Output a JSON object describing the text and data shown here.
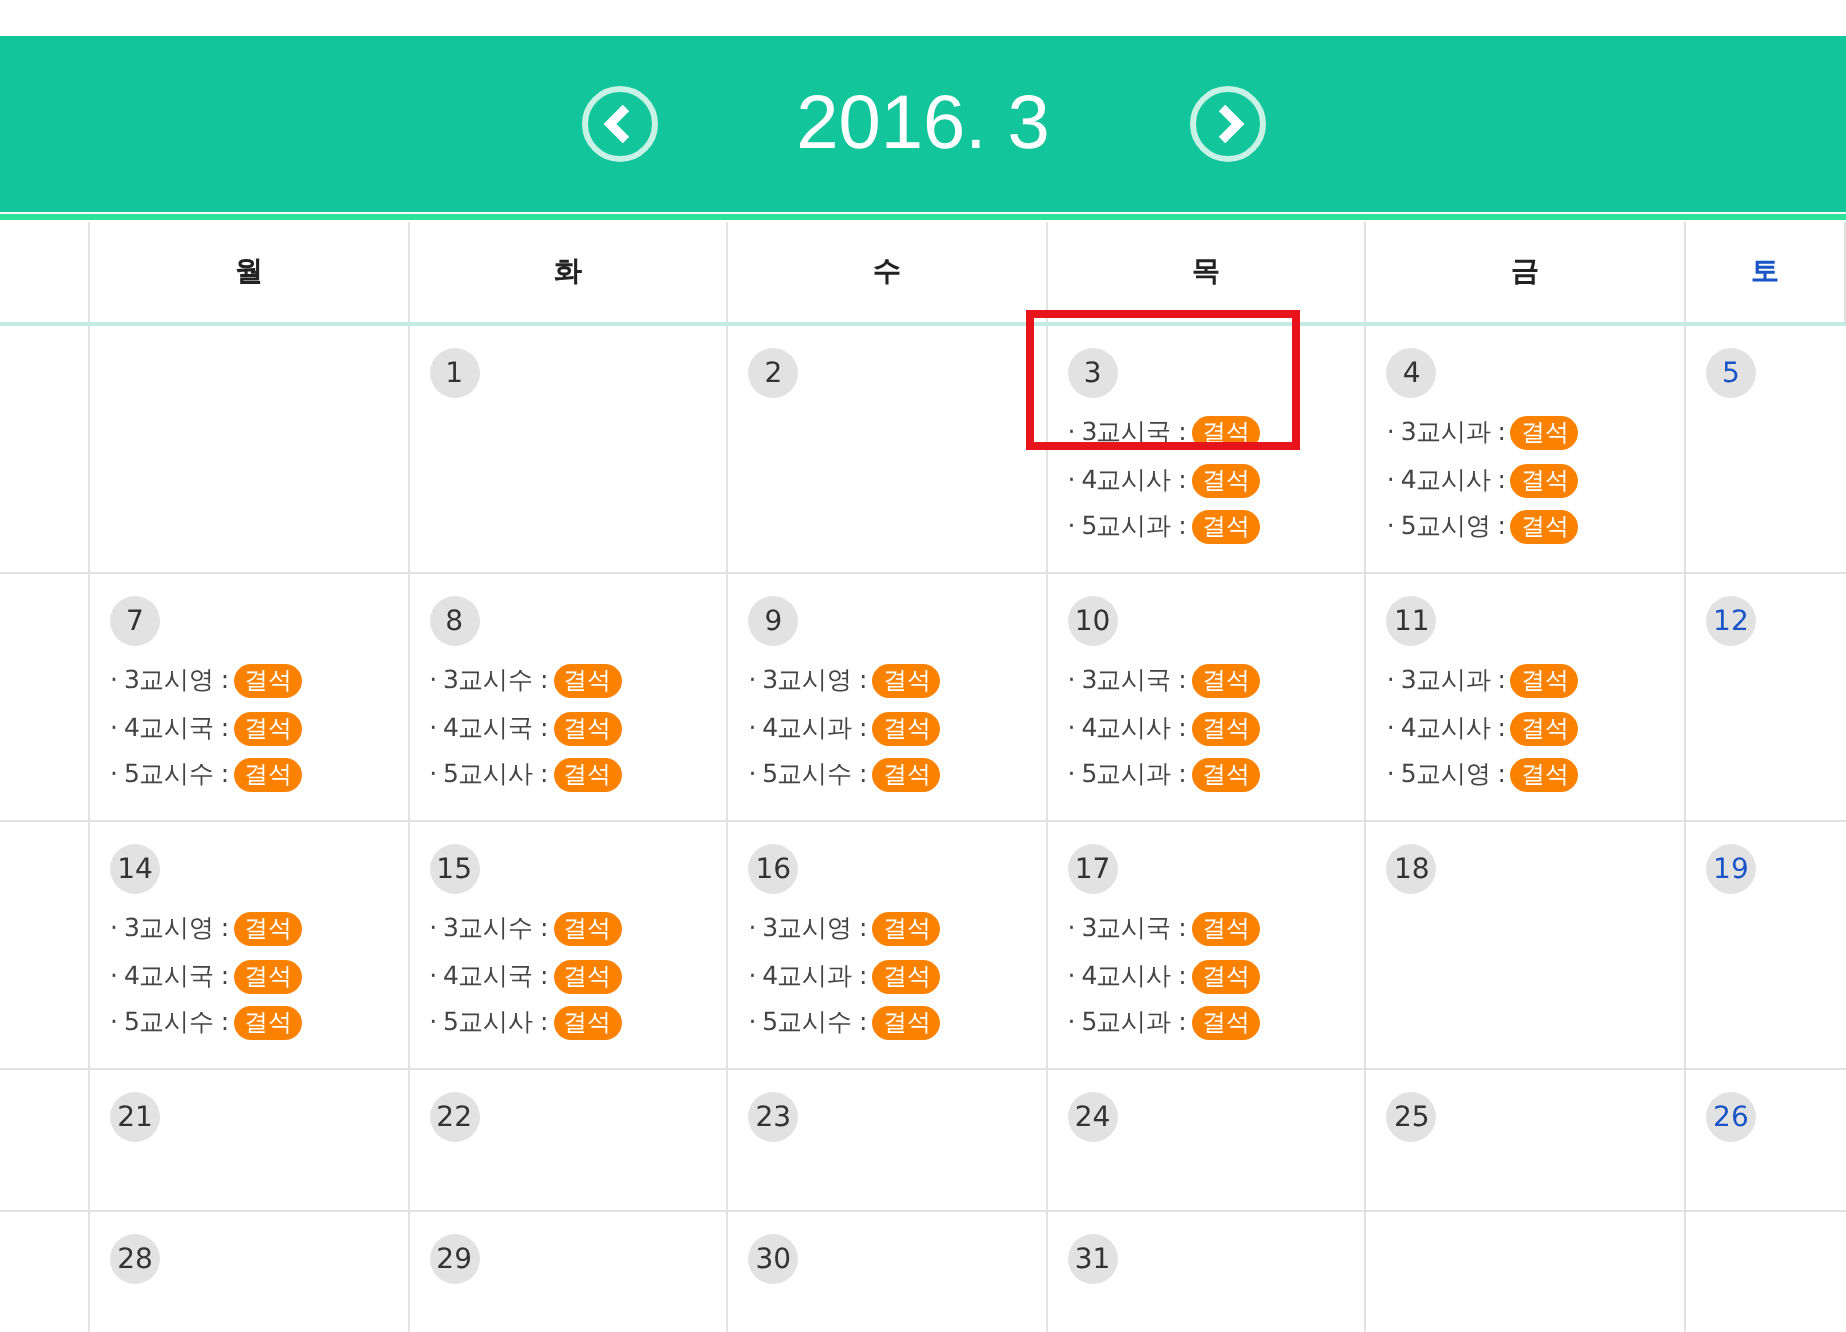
{
  "header": {
    "title": "2016. 3"
  },
  "weekdays": [
    {
      "label": "월",
      "kind": "weekday"
    },
    {
      "label": "화",
      "kind": "weekday"
    },
    {
      "label": "수",
      "kind": "weekday"
    },
    {
      "label": "목",
      "kind": "weekday"
    },
    {
      "label": "금",
      "kind": "weekday"
    },
    {
      "label": "토",
      "kind": "saturday"
    }
  ],
  "weeks": [
    {
      "days": [
        {
          "kind": "weekday"
        },
        {
          "date": "1",
          "kind": "weekday"
        },
        {
          "date": "2",
          "kind": "weekday"
        },
        {
          "date": "3",
          "kind": "weekday",
          "entries": [
            {
              "label": "· 3교시국 :",
              "status": "결석",
              "highlighted": true
            },
            {
              "label": "· 4교시사 :",
              "status": "결석",
              "highlighted": false
            },
            {
              "label": "· 5교시과 :",
              "status": "결석",
              "highlighted": false
            }
          ]
        },
        {
          "date": "4",
          "kind": "weekday",
          "entries": [
            {
              "label": "· 3교시과 :",
              "status": "결석",
              "highlighted": false
            },
            {
              "label": "· 4교시사 :",
              "status": "결석",
              "highlighted": false
            },
            {
              "label": "· 5교시영 :",
              "status": "결석",
              "highlighted": false
            }
          ]
        },
        {
          "date": "5",
          "kind": "saturday"
        }
      ]
    },
    {
      "days": [
        {
          "date": "7",
          "kind": "weekday",
          "entries": [
            {
              "label": "· 3교시영 :",
              "status": "결석",
              "highlighted": false
            },
            {
              "label": "· 4교시국 :",
              "status": "결석",
              "highlighted": false
            },
            {
              "label": "· 5교시수 :",
              "status": "결석",
              "highlighted": false
            }
          ]
        },
        {
          "date": "8",
          "kind": "weekday",
          "entries": [
            {
              "label": "· 3교시수 :",
              "status": "결석",
              "highlighted": false
            },
            {
              "label": "· 4교시국 :",
              "status": "결석",
              "highlighted": false
            },
            {
              "label": "· 5교시사 :",
              "status": "결석",
              "highlighted": false
            }
          ]
        },
        {
          "date": "9",
          "kind": "weekday",
          "entries": [
            {
              "label": "· 3교시영 :",
              "status": "결석",
              "highlighted": false
            },
            {
              "label": "· 4교시과 :",
              "status": "결석",
              "highlighted": false
            },
            {
              "label": "· 5교시수 :",
              "status": "결석",
              "highlighted": false
            }
          ]
        },
        {
          "date": "10",
          "kind": "weekday",
          "entries": [
            {
              "label": "· 3교시국 :",
              "status": "결석",
              "highlighted": false
            },
            {
              "label": "· 4교시사 :",
              "status": "결석",
              "highlighted": false
            },
            {
              "label": "· 5교시과 :",
              "status": "결석",
              "highlighted": false
            }
          ]
        },
        {
          "date": "11",
          "kind": "weekday",
          "entries": [
            {
              "label": "· 3교시과 :",
              "status": "결석",
              "highlighted": false
            },
            {
              "label": "· 4교시사 :",
              "status": "결석",
              "highlighted": false
            },
            {
              "label": "· 5교시영 :",
              "status": "결석",
              "highlighted": false
            }
          ]
        },
        {
          "date": "12",
          "kind": "saturday"
        }
      ]
    },
    {
      "days": [
        {
          "date": "14",
          "kind": "weekday",
          "entries": [
            {
              "label": "· 3교시영 :",
              "status": "결석",
              "highlighted": false
            },
            {
              "label": "· 4교시국 :",
              "status": "결석",
              "highlighted": false
            },
            {
              "label": "· 5교시수 :",
              "status": "결석",
              "highlighted": false
            }
          ]
        },
        {
          "date": "15",
          "kind": "weekday",
          "entries": [
            {
              "label": "· 3교시수 :",
              "status": "결석",
              "highlighted": false
            },
            {
              "label": "· 4교시국 :",
              "status": "결석",
              "highlighted": false
            },
            {
              "label": "· 5교시사 :",
              "status": "결석",
              "highlighted": false
            }
          ]
        },
        {
          "date": "16",
          "kind": "weekday",
          "entries": [
            {
              "label": "· 3교시영 :",
              "status": "결석",
              "highlighted": false
            },
            {
              "label": "· 4교시과 :",
              "status": "결석",
              "highlighted": false
            },
            {
              "label": "· 5교시수 :",
              "status": "결석",
              "highlighted": false
            }
          ]
        },
        {
          "date": "17",
          "kind": "weekday",
          "entries": [
            {
              "label": "· 3교시국 :",
              "status": "결석",
              "highlighted": false
            },
            {
              "label": "· 4교시사 :",
              "status": "결석",
              "highlighted": false
            },
            {
              "label": "· 5교시과 :",
              "status": "결석",
              "highlighted": false
            }
          ]
        },
        {
          "date": "18",
          "kind": "weekday"
        },
        {
          "date": "19",
          "kind": "saturday"
        }
      ]
    },
    {
      "days": [
        {
          "date": "21",
          "kind": "weekday"
        },
        {
          "date": "22",
          "kind": "weekday"
        },
        {
          "date": "23",
          "kind": "weekday"
        },
        {
          "date": "24",
          "kind": "weekday"
        },
        {
          "date": "25",
          "kind": "weekday"
        },
        {
          "date": "26",
          "kind": "saturday"
        }
      ]
    },
    {
      "days": [
        {
          "date": "28",
          "kind": "weekday"
        },
        {
          "date": "29",
          "kind": "weekday"
        },
        {
          "date": "30",
          "kind": "weekday"
        },
        {
          "date": "31",
          "kind": "weekday"
        },
        {
          "kind": "weekday"
        },
        {
          "kind": "saturday"
        }
      ]
    }
  ]
}
